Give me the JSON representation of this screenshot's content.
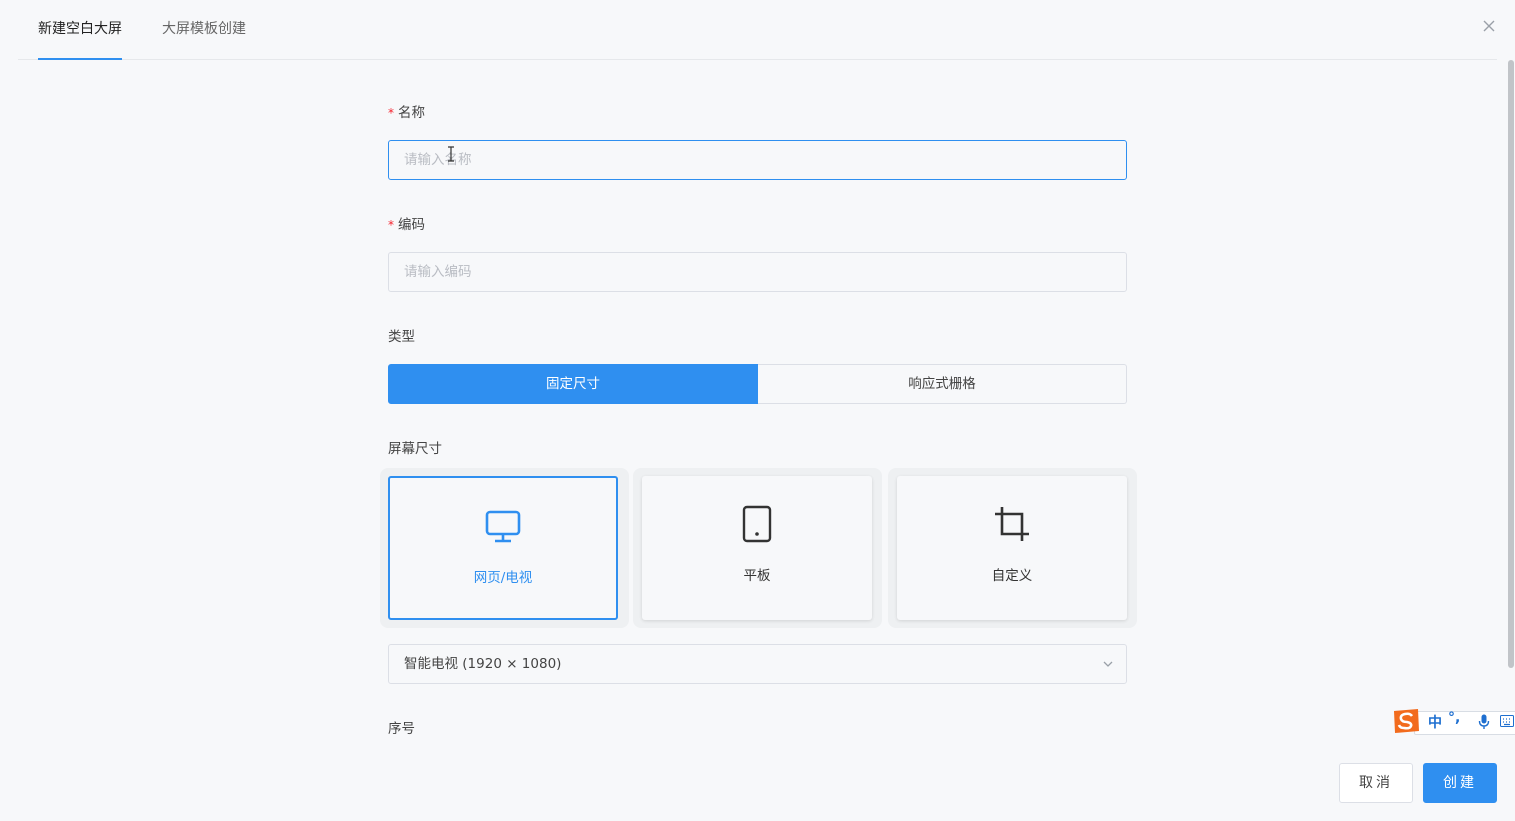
{
  "tabs": [
    {
      "label": "新建空白大屏",
      "active": true
    },
    {
      "label": "大屏模板创建",
      "active": false
    }
  ],
  "form": {
    "name": {
      "label": "名称",
      "required": true,
      "placeholder": "请输入名称",
      "value": ""
    },
    "code": {
      "label": "编码",
      "required": true,
      "placeholder": "请输入编码",
      "value": ""
    },
    "type": {
      "label": "类型",
      "options": [
        "固定尺寸",
        "响应式栅格"
      ],
      "selected": "固定尺寸"
    },
    "screen_size": {
      "label": "屏幕尺寸",
      "options": [
        {
          "label": "网页/电视",
          "icon": "monitor-icon",
          "selected": true
        },
        {
          "label": "平板",
          "icon": "tablet-icon",
          "selected": false
        },
        {
          "label": "自定义",
          "icon": "crop-icon",
          "selected": false
        }
      ],
      "preset_value": "智能电视 (1920 × 1080)"
    },
    "order": {
      "label": "序号"
    }
  },
  "actions": {
    "cancel_label": "取消",
    "create_label": "创建"
  },
  "ime": {
    "mode_label": "中",
    "punct_label": "°,"
  },
  "colors": {
    "accent": "#2f8ff0",
    "required": "#f5222d"
  }
}
